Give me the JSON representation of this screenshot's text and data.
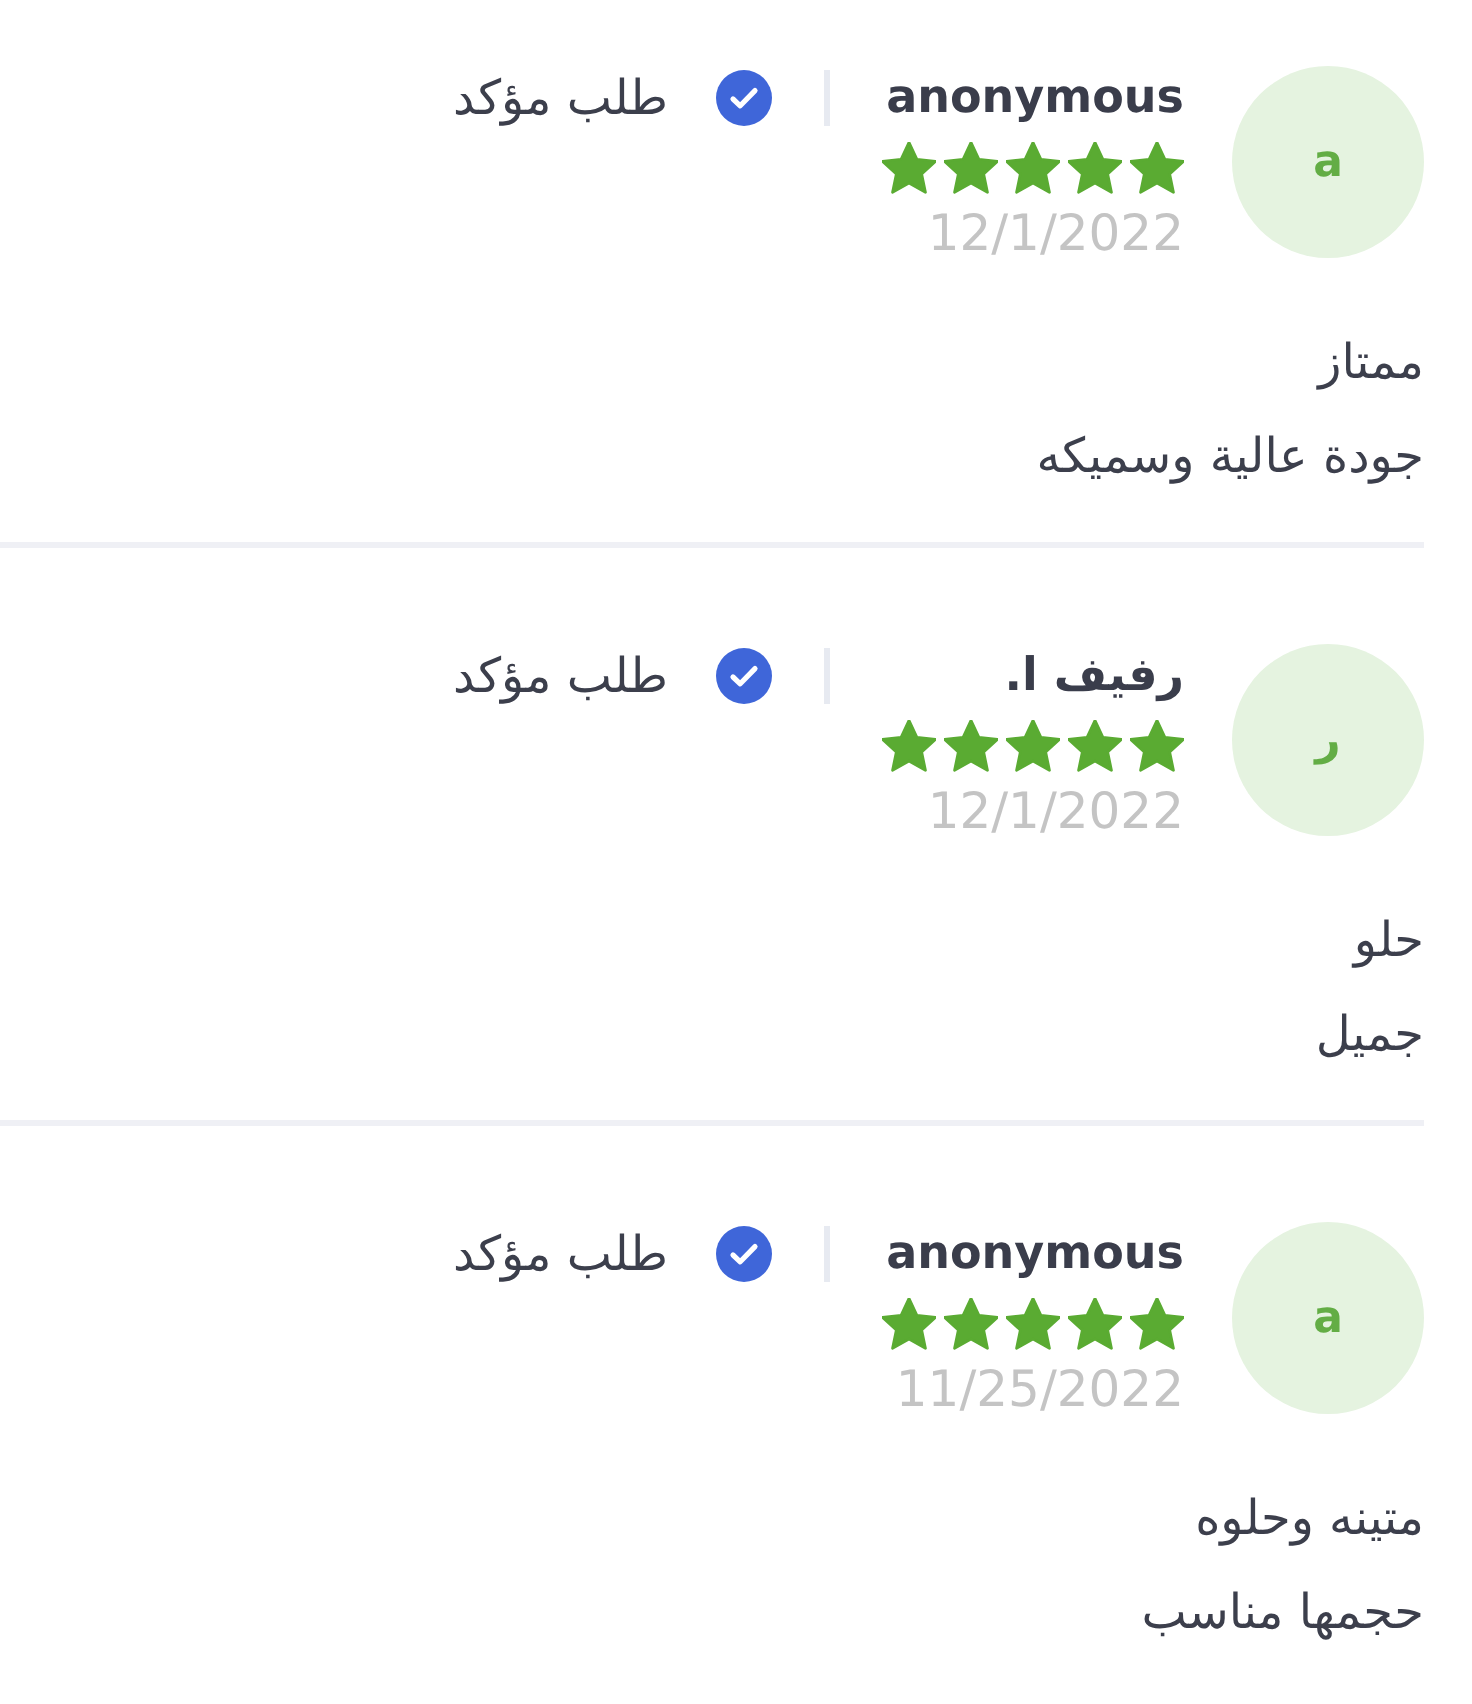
{
  "reviews": [
    {
      "avatar": "a",
      "name": "anonymous",
      "stars": 5,
      "date": "12/1/2022",
      "verified": true,
      "verified_label": "طلب مؤكد",
      "title": "ممتاز",
      "text": "جودة عالية وسميكه"
    },
    {
      "avatar": "ر",
      "name": "رفيف ا.",
      "stars": 5,
      "date": "12/1/2022",
      "verified": true,
      "verified_label": "طلب مؤكد",
      "title": "حلو",
      "text": "جميل"
    },
    {
      "avatar": "a",
      "name": "anonymous",
      "stars": 5,
      "date": "11/25/2022",
      "verified": true,
      "verified_label": "طلب مؤكد",
      "title": "متينه وحلوه",
      "text": "حجمها مناسب"
    }
  ]
}
